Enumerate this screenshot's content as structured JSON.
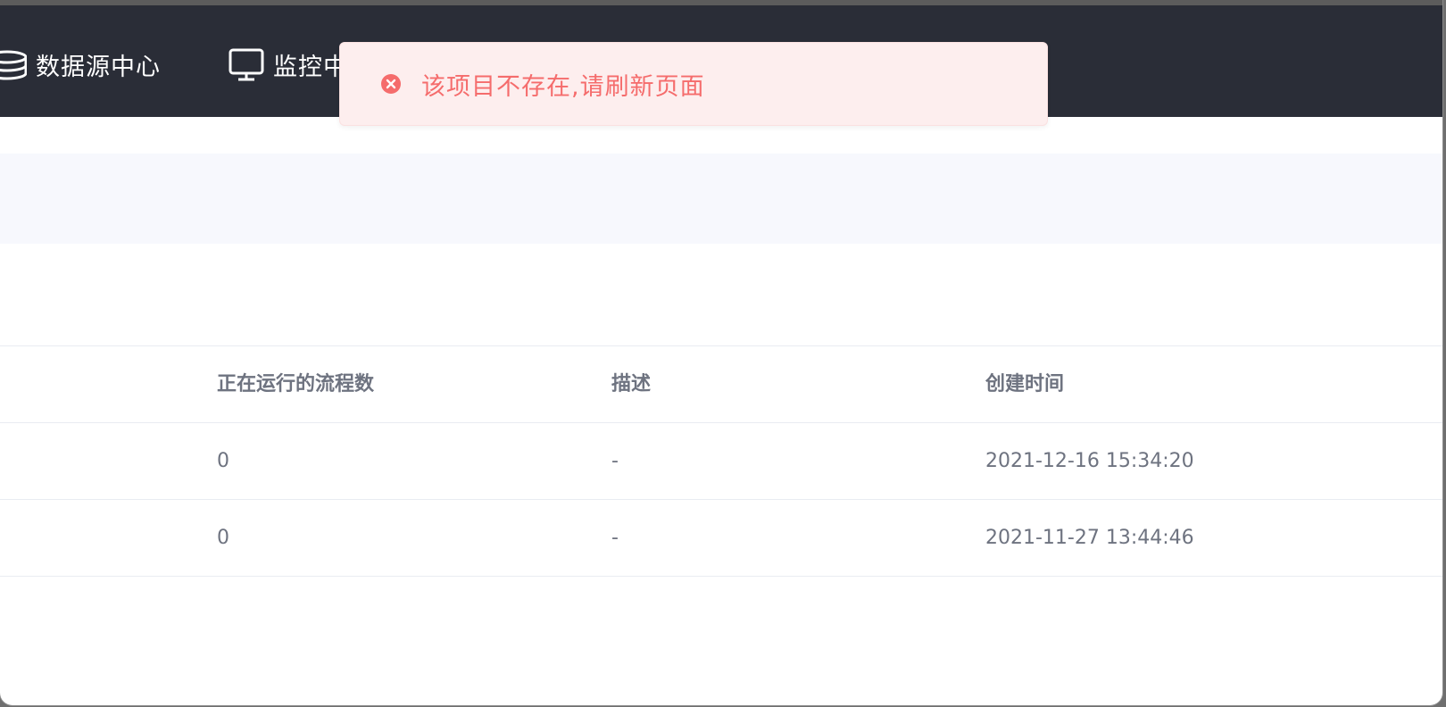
{
  "nav": {
    "items": [
      {
        "label": "数据源中心",
        "icon": "database-icon"
      },
      {
        "label": "监控中",
        "icon": "monitor-icon"
      }
    ]
  },
  "toast": {
    "message": "该项目不存在,请刷新页面",
    "icon": "error-circle-icon",
    "color": "#f56c6c",
    "background": "#fdeeee"
  },
  "table": {
    "headers": [
      "正在运行的流程数",
      "描述",
      "创建时间"
    ],
    "rows": [
      {
        "running": "0",
        "description": "-",
        "created": "2021-12-16 15:34:20"
      },
      {
        "running": "0",
        "description": "-",
        "created": "2021-11-27 13:44:46"
      }
    ]
  },
  "colors": {
    "nav_background": "#2a2d37",
    "filter_background": "#f7f8fd",
    "text_primary": "#3b3f48",
    "text_secondary": "#6e7380"
  }
}
